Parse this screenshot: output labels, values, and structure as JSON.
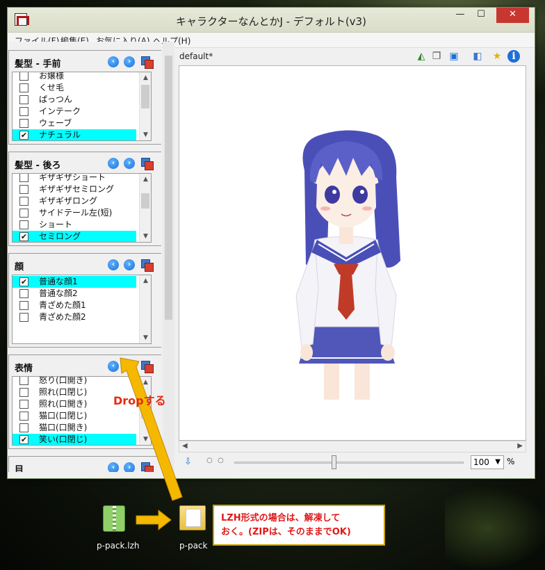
{
  "window": {
    "title": "キャラクターなんとかJ - デフォルト(v3)",
    "controls": {
      "minimize": "—",
      "maximize": "☐",
      "close": "✕"
    }
  },
  "menu": [
    "ファイル(F)",
    "編集(E)",
    "お気に入り(A)",
    "ヘルプ(H)"
  ],
  "groups": [
    {
      "title": "髪型 - 手前",
      "items": [
        {
          "label": "お嬢様",
          "checked": false
        },
        {
          "label": "くせ毛",
          "checked": false
        },
        {
          "label": "ぱっつん",
          "checked": false
        },
        {
          "label": "インテーク",
          "checked": false
        },
        {
          "label": "ウェーブ",
          "checked": false
        },
        {
          "label": "ナチュラル",
          "checked": true
        }
      ]
    },
    {
      "title": "髪型 - 後ろ",
      "items": [
        {
          "label": "ギザギザショート",
          "checked": false
        },
        {
          "label": "ギザギザセミロング",
          "checked": false
        },
        {
          "label": "ギザギザロング",
          "checked": false
        },
        {
          "label": "サイドテール左(短)",
          "checked": false
        },
        {
          "label": "ショート",
          "checked": false
        },
        {
          "label": "セミロング",
          "checked": true
        }
      ]
    },
    {
      "title": "顔",
      "items": [
        {
          "label": "普通な顔1",
          "checked": true
        },
        {
          "label": "普通な顔2",
          "checked": false
        },
        {
          "label": "青ざめた顔1",
          "checked": false
        },
        {
          "label": "青ざめた顔2",
          "checked": false
        }
      ]
    },
    {
      "title": "表情",
      "items": [
        {
          "label": "怒り(口開き)",
          "checked": false
        },
        {
          "label": "照れ(口閉じ)",
          "checked": false
        },
        {
          "label": "照れ(口開き)",
          "checked": false
        },
        {
          "label": "猫口(口閉じ)",
          "checked": false
        },
        {
          "label": "猫口(口開き)",
          "checked": false
        },
        {
          "label": "笑い(口閉じ)",
          "checked": true
        }
      ]
    },
    {
      "title": "目",
      "items": []
    }
  ],
  "document": {
    "tab": "default*"
  },
  "zoom": {
    "value": "100",
    "unit": "%"
  },
  "overlay": {
    "drop_label": "Dropする",
    "callout_line1": "LZH形式の場合は、解凍して",
    "callout_line2": "おく。(ZIPは、そのままでOK)",
    "file_lzh": "p-pack.lzh",
    "folder": "p-pack"
  },
  "colors": {
    "selection": "#00ffff",
    "arrow": "#f5b800",
    "callout_text": "#e01818"
  }
}
